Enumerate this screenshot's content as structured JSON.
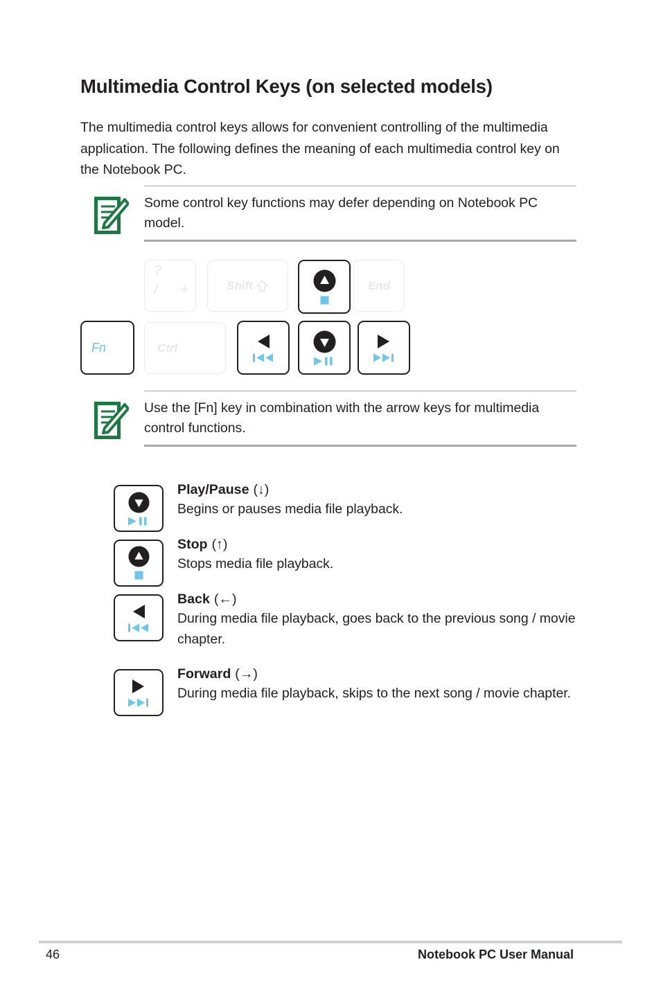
{
  "page": {
    "heading": "Multimedia Control Keys (on selected models)",
    "intro": "The multimedia control keys allows for convenient controlling of the multimedia application. The following defines the meaning of each multimedia control key on the Notebook PC."
  },
  "notes": [
    {
      "icon": "note-pencil-icon",
      "text": "Some control key functions may defer depending on Notebook PC model."
    },
    {
      "icon": "note-pencil-icon",
      "text": "Use the [Fn] key in combination with the arrow keys for multimedia control functions."
    }
  ],
  "keyboard": {
    "keys": [
      {
        "name": "question-slash-key",
        "state": "dim",
        "glyphs": [
          "?",
          "/",
          "+"
        ]
      },
      {
        "name": "shift-key",
        "state": "dim",
        "label": "Shift"
      },
      {
        "name": "stop-up-key",
        "state": "active",
        "primary": "up-triangle-in-circle",
        "secondary": "stop-square"
      },
      {
        "name": "end-key",
        "state": "dim",
        "label": "End"
      },
      {
        "name": "fn-key",
        "state": "active",
        "label": "Fn"
      },
      {
        "name": "ctrl-key",
        "state": "dim",
        "label": "Ctrl"
      },
      {
        "name": "back-left-key",
        "state": "active",
        "primary": "left-triangle",
        "secondary": "previous-track"
      },
      {
        "name": "play-pause-down-key",
        "state": "active",
        "primary": "down-triangle-in-circle",
        "secondary": "play-pause"
      },
      {
        "name": "forward-right-key",
        "state": "active",
        "primary": "right-triangle",
        "secondary": "next-track"
      }
    ]
  },
  "descriptions": [
    {
      "key_icon": "play-pause-key-icon",
      "title_bold": "Play/Pause",
      "title_arrow": "(↓)",
      "text": "Begins or pauses media file playback."
    },
    {
      "key_icon": "stop-key-icon",
      "title_bold": "Stop",
      "title_arrow": "(↑)",
      "text": "Stops media file playback."
    },
    {
      "key_icon": "back-key-icon",
      "title_bold": "Back",
      "title_arrow": "(←)",
      "text": "During media file playback, goes back to the previous song / movie chapter."
    },
    {
      "key_icon": "forward-key-icon",
      "title_bold": "Forward",
      "title_arrow": "(→)",
      "text": "During media file playback, skips to the next song / movie chapter."
    }
  ],
  "footer": {
    "page_number": "46",
    "manual_title": "Notebook PC User Manual"
  },
  "colors": {
    "accent_blue": "#6ec7ea",
    "note_green": "#1a7a42",
    "text": "#231f20",
    "dim_key": "#ececec",
    "rule_gray": "#a7a9ac"
  }
}
